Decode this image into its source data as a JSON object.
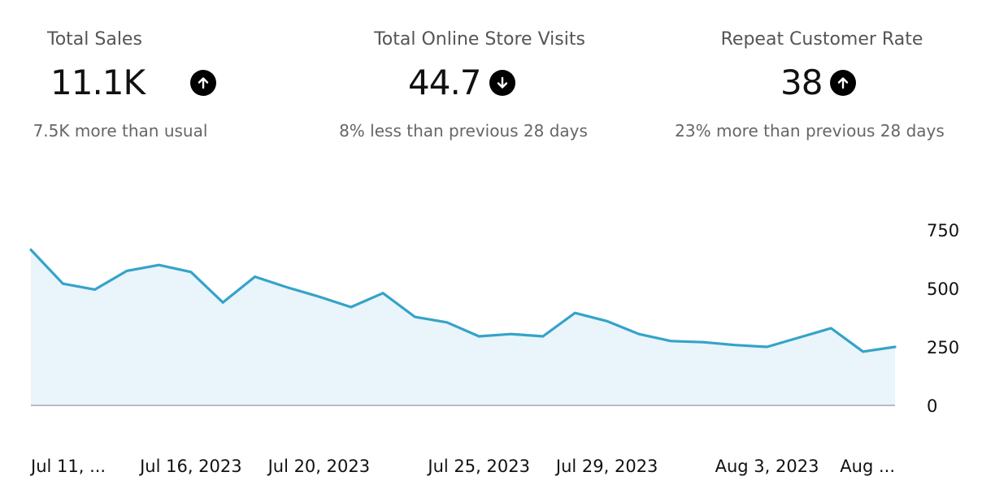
{
  "kpis": [
    {
      "title": "Total Sales",
      "value": "11.1K",
      "direction": "up",
      "icon": "arrow-up-icon",
      "sub": "7.5K more than usual"
    },
    {
      "title": "Total Online Store Visits",
      "value": "44.7",
      "direction": "down",
      "icon": "arrow-down-icon",
      "sub": "8% less than previous 28 days"
    },
    {
      "title": "Repeat Customer Rate",
      "value": "38",
      "direction": "up",
      "icon": "arrow-up-icon",
      "sub": "23% more than previous 28 days"
    }
  ],
  "chart_data": {
    "type": "area",
    "ylim": [
      0,
      750
    ],
    "y_ticks": [
      "750",
      "500",
      "250",
      "0"
    ],
    "y_tick_values": [
      750,
      500,
      250,
      0
    ],
    "x_tick_labels": [
      "Jul 11, ...",
      "Jul 16, 2023",
      "Jul 20, 2023",
      "Jul 25, 2023",
      "Jul 29, 2023",
      "Aug 3, 2023",
      "Aug ..."
    ],
    "x_tick_indices": [
      0,
      5,
      9,
      14,
      18,
      23,
      27
    ],
    "series": [
      {
        "values": [
          665,
          520,
          495,
          575,
          600,
          570,
          440,
          550,
          505,
          465,
          420,
          480,
          378,
          355,
          295,
          305,
          295,
          395,
          360,
          305,
          275,
          270,
          258,
          250,
          290,
          330,
          230,
          250
        ],
        "color": "#35a3c9",
        "fill": "#e9f5fa"
      }
    ],
    "baseline_color": "#9aa9b5"
  }
}
